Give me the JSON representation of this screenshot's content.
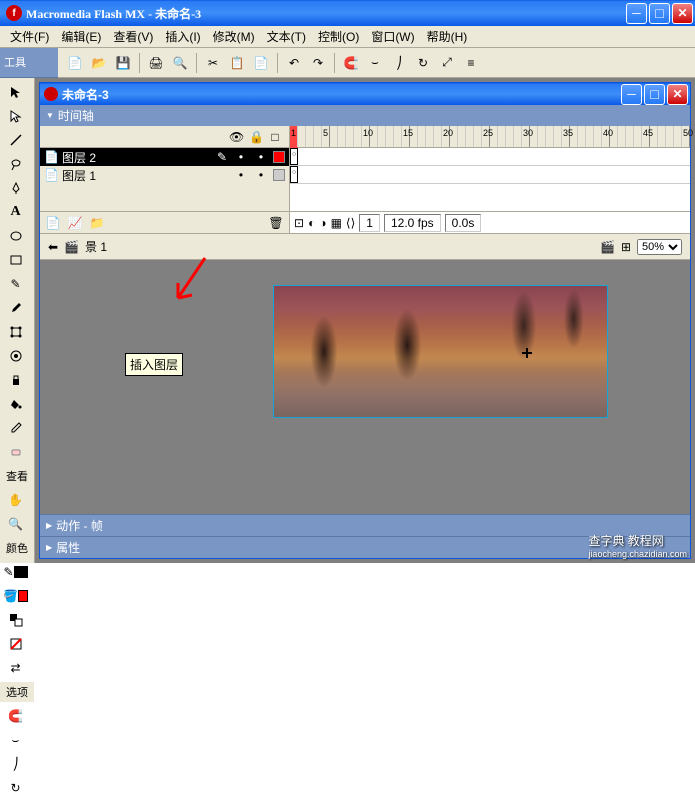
{
  "app": {
    "title": "Macromedia Flash MX - 未命名-3"
  },
  "menu": {
    "file": "文件(F)",
    "edit": "编辑(E)",
    "view": "查看(V)",
    "insert": "插入(I)",
    "modify": "修改(M)",
    "text": "文本(T)",
    "control": "控制(O)",
    "window": "窗口(W)",
    "help": "帮助(H)"
  },
  "panels": {
    "tools": "工具",
    "view": "查看",
    "colors": "颜色",
    "options": "选项"
  },
  "doc": {
    "title": "未命名-3"
  },
  "timeline": {
    "header": "时间轴",
    "layers": [
      {
        "name": "图层 2",
        "selected": true,
        "color": "#ff0000"
      },
      {
        "name": "图层 1",
        "selected": false,
        "color": "#cccccc"
      }
    ],
    "frame": "1",
    "fps": "12.0 fps",
    "time": "0.0s",
    "ruler_ticks": [
      "1",
      "5",
      "10",
      "15",
      "20",
      "25",
      "30",
      "35",
      "40",
      "45",
      "50"
    ]
  },
  "scene": {
    "label": "景 1",
    "zoom": "50%"
  },
  "tooltip": "插入图层",
  "collapse": {
    "actions": "动作 - 帧",
    "properties": "属性"
  },
  "colors": {
    "stroke": "#000000",
    "fill": "#ff0000"
  },
  "watermark": {
    "main": "查字典 教程网",
    "sub": "jiaocheng.chazidian.com"
  }
}
